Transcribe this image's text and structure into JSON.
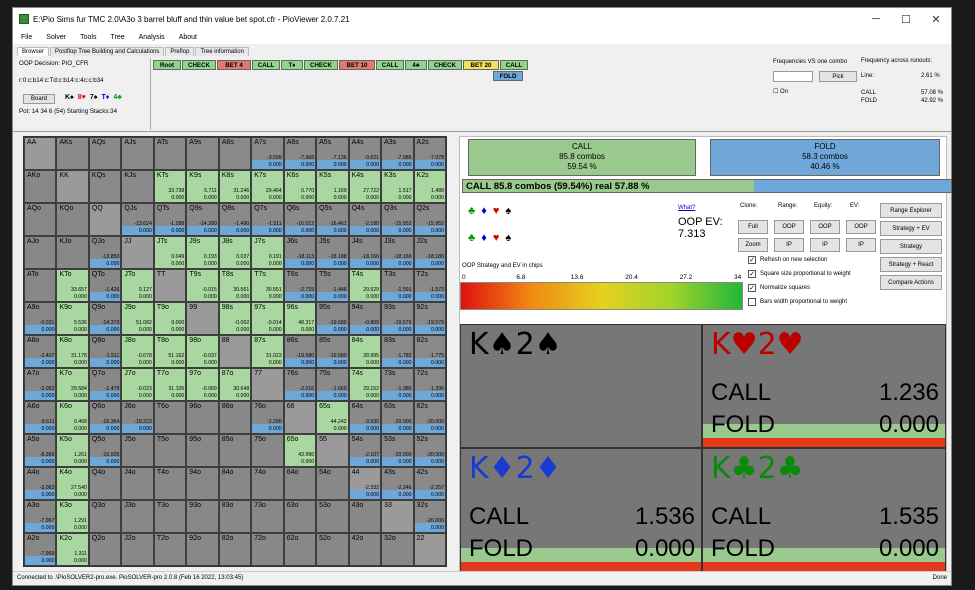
{
  "window": {
    "title": "E:\\Pio Sims fur TMC 2.0\\A3o 3 barrel bluff and thin value bet spot.cfr - PioViewer 2.0.7.21",
    "min": "─",
    "max": "☐",
    "close": "✕"
  },
  "menu": [
    "File",
    "Solver",
    "Tools",
    "Tree",
    "Analysis",
    "About"
  ],
  "tabs": [
    "Browser",
    "Postflop Tree Building and Calculations",
    "Preflop",
    "Tree information"
  ],
  "info": {
    "decision": "OOP Decision:  PIO_CFR",
    "line": "r:0:c:b14:c:Td:c:b14:c:4c:c:b34",
    "board_btn": "Board",
    "pot": "Pot: 14 34 6 (54) Starting Stacks:34"
  },
  "board_cards": [
    {
      "t": "K♠",
      "c": "#000"
    },
    {
      "t": "8♥",
      "c": "#d00"
    },
    {
      "t": "7♠",
      "c": "#000"
    },
    {
      "t": "T♦",
      "c": "#00c"
    },
    {
      "t": "4♣",
      "c": "#090"
    }
  ],
  "tree_nodes": [
    "Root",
    "CHECK",
    "BET 4",
    "CALL",
    "T♦",
    "CHECK",
    "BET 10",
    "CALL",
    "4♣",
    "CHECK",
    "BET 20",
    "CALL",
    "FOLD"
  ],
  "freq": {
    "title1": "Frequencies VS one combo",
    "title2": "Frequency across runouts:",
    "pick": "Pick",
    "on": "On",
    "line_label": "Line:",
    "line_val": "2.61 %",
    "call_label": "CALL",
    "call_val": "57.08 %",
    "fold_label": "FOLD",
    "fold_val": "42.92 %"
  },
  "grid": [
    [
      "AA",
      "AKs",
      "AQs",
      "AJs",
      "ATs",
      "A9s",
      "A8s",
      "A7s",
      "A6s",
      "A5s",
      "A4s",
      "A3s",
      "A2s"
    ],
    [
      "AKo",
      "KK",
      "KQs",
      "KJs",
      "KTs",
      "K9s",
      "K8s",
      "K7s",
      "K6s",
      "K5s",
      "K4s",
      "K3s",
      "K2s"
    ],
    [
      "AQo",
      "KQo",
      "QQ",
      "QJs",
      "QTs",
      "Q9s",
      "Q8s",
      "Q7s",
      "Q6s",
      "Q5s",
      "Q4s",
      "Q3s",
      "Q2s"
    ],
    [
      "AJo",
      "KJo",
      "QJo",
      "JJ",
      "JTs",
      "J9s",
      "J8s",
      "J7s",
      "J6s",
      "J5s",
      "J4s",
      "J3s",
      "J2s"
    ],
    [
      "ATo",
      "KTo",
      "QTo",
      "JTo",
      "TT",
      "T9s",
      "T8s",
      "T7s",
      "T6s",
      "T5s",
      "T4s",
      "T3s",
      "T2s"
    ],
    [
      "A9o",
      "K9o",
      "Q9o",
      "J9o",
      "T9o",
      "99",
      "98s",
      "97s",
      "96s",
      "95s",
      "94s",
      "93s",
      "92s"
    ],
    [
      "A8o",
      "K8o",
      "Q8o",
      "J8o",
      "T8o",
      "98o",
      "88",
      "87s",
      "86s",
      "85s",
      "84s",
      "83s",
      "82s"
    ],
    [
      "A7o",
      "K7o",
      "Q7o",
      "J7o",
      "T7o",
      "97o",
      "87o",
      "77",
      "76s",
      "75s",
      "74s",
      "73s",
      "72s"
    ],
    [
      "A6o",
      "K6o",
      "Q6o",
      "J6o",
      "T6o",
      "96o",
      "86o",
      "76o",
      "66",
      "65s",
      "64s",
      "63s",
      "62s"
    ],
    [
      "A5o",
      "K5o",
      "Q5o",
      "J5o",
      "T5o",
      "95o",
      "85o",
      "75o",
      "65o",
      "55",
      "54s",
      "53s",
      "52s"
    ],
    [
      "A4o",
      "K4o",
      "Q4o",
      "J4o",
      "T4o",
      "94o",
      "84o",
      "74o",
      "64o",
      "54o",
      "44",
      "43s",
      "42s"
    ],
    [
      "A3o",
      "K3o",
      "Q3o",
      "J3o",
      "T3o",
      "93o",
      "83o",
      "73o",
      "63o",
      "53o",
      "43o",
      "33",
      "32s"
    ],
    [
      "A2o",
      "K2o",
      "Q2o",
      "J2o",
      "T2o",
      "92o",
      "82o",
      "72o",
      "62o",
      "52o",
      "42o",
      "32o",
      "22"
    ]
  ],
  "grid_vals": {
    "0-7": [
      "-3.599",
      "0.000"
    ],
    "0-8": [
      "-7.968",
      "0.000"
    ],
    "0-9": [
      "-7.136",
      "0.000"
    ],
    "0-10": [
      "-0.621",
      "0.000"
    ],
    "0-11": [
      "-7.086",
      "0.000"
    ],
    "0-12": [
      "-7.078",
      "0.000"
    ],
    "1-4": [
      "33.738",
      "0.000"
    ],
    "1-5": [
      "5.711",
      "0.000"
    ],
    "1-6": [
      "31.246",
      "0.000"
    ],
    "1-7": [
      "29.464",
      "0.000"
    ],
    "1-8": [
      "0.770",
      "0.000"
    ],
    "1-9": [
      "1.169",
      "0.000"
    ],
    "1-10": [
      "27.722",
      "0.000"
    ],
    "1-11": [
      "1.517",
      "0.000"
    ],
    "1-12": [
      "1.488",
      "0.000"
    ],
    "2-3": [
      "-13.624",
      "0.000"
    ],
    "2-4": [
      "-1.288",
      "0.000"
    ],
    "2-5": [
      "-14.390",
      "0.000"
    ],
    "2-6": [
      "-1.490",
      "0.000"
    ],
    "2-7": [
      "-1.511",
      "0.000"
    ],
    "2-8": [
      "-16.012",
      "0.000"
    ],
    "2-9": [
      "-16.461",
      "0.000"
    ],
    "2-10": [
      "-2.190",
      "0.000"
    ],
    "2-11": [
      "-15.952",
      "0.000"
    ],
    "2-12": [
      "-15.952",
      "0.000"
    ],
    "3-2": [
      "-13.850",
      "0.000"
    ],
    "3-4": [
      "0.049",
      "0.000"
    ],
    "3-5": [
      "0.193",
      "0.000"
    ],
    "3-6": [
      "0.037",
      "0.000"
    ],
    "3-7": [
      "0.191",
      "0.000"
    ],
    "3-8": [
      "-18.113",
      "0.000"
    ],
    "3-9": [
      "-18.188",
      "0.000"
    ],
    "3-10": [
      "-18.166",
      "0.000"
    ],
    "3-11": [
      "-18.166",
      "0.000"
    ],
    "3-12": [
      "-18.180",
      "0.000"
    ],
    "4-1": [
      "33.657",
      "0.000"
    ],
    "4-2": [
      "-1.426",
      "0.000"
    ],
    "4-3": [
      "0.127",
      "0.000"
    ],
    "4-5": [
      "-0.015",
      "0.000"
    ],
    "4-6": [
      "30.561",
      "0.000"
    ],
    "4-7": [
      "30.551",
      "0.000"
    ],
    "4-8": [
      "-2.715",
      "0.000"
    ],
    "4-9": [
      "-1.446",
      "0.000"
    ],
    "4-10": [
      "29.529",
      "0.000"
    ],
    "4-11": [
      "-1.591",
      "0.000"
    ],
    "4-12": [
      "-1.573",
      "0.000"
    ],
    "5-0": [
      "-0.031",
      "0.000"
    ],
    "5-1": [
      "5.536",
      "0.000"
    ],
    "5-2": [
      "-14.373",
      "0.000"
    ],
    "5-3": [
      "51.082",
      "0.000"
    ],
    "5-4": [
      "0.000",
      "0.000"
    ],
    "5-6": [
      "-0.062",
      "0.000"
    ],
    "5-7": [
      "-0.014",
      "0.000"
    ],
    "5-8": [
      "48.317",
      "0.000"
    ],
    "5-9": [
      "-19.580",
      "0.000"
    ],
    "5-10": [
      "-0.809",
      "0.000"
    ],
    "5-11": [
      "-19.579",
      "0.000"
    ],
    "5-12": [
      "-19.579",
      "0.000"
    ],
    "6-0": [
      "-2.407",
      "0.000"
    ],
    "6-1": [
      "31.178",
      "0.000"
    ],
    "6-2": [
      "-1.511",
      "0.000"
    ],
    "6-3": [
      "-0.078",
      "0.000"
    ],
    "6-4": [
      "51.162",
      "0.000"
    ],
    "6-5": [
      "-0.037",
      "0.000"
    ],
    "6-7": [
      "31.023",
      "0.000"
    ],
    "6-8": [
      "-19.580",
      "0.000"
    ],
    "6-9": [
      "-19.580",
      "0.000"
    ],
    "6-10": [
      "28.995",
      "0.000"
    ],
    "6-11": [
      "-1.782",
      "0.000"
    ],
    "6-12": [
      "-1.775",
      "0.000"
    ],
    "7-0": [
      "-2.052",
      "0.000"
    ],
    "7-1": [
      "29.584",
      "0.000"
    ],
    "7-2": [
      "-1.478",
      "0.000"
    ],
    "7-3": [
      "-0.023",
      "0.000"
    ],
    "7-4": [
      "31.105",
      "0.000"
    ],
    "7-5": [
      "-0.069",
      "0.000"
    ],
    "7-6": [
      "30.648",
      "0.000"
    ],
    "7-8": [
      "-2.016",
      "0.000"
    ],
    "7-9": [
      "-1.669",
      "0.000"
    ],
    "7-10": [
      "29.152",
      "0.000"
    ],
    "7-11": [
      "-1.380",
      "0.000"
    ],
    "7-12": [
      "-1.396",
      "0.000"
    ],
    "8-0": [
      "-8.611",
      "0.000"
    ],
    "8-1": [
      "0.468",
      "0.000"
    ],
    "8-2": [
      "-16.364",
      "0.000"
    ],
    "8-3": [
      "-18.223",
      "0.000"
    ],
    "8-7": [
      "-2.290",
      "0.000"
    ],
    "8-9": [
      "44.242",
      "0.000"
    ],
    "8-10": [
      "-3.530",
      "0.000"
    ],
    "8-11": [
      "-20.000",
      "0.000"
    ],
    "8-12": [
      "-20.000",
      "0.000"
    ],
    "9-0": [
      "-8.366",
      "0.000"
    ],
    "9-1": [
      "1.261",
      "0.000"
    ],
    "9-2": [
      "-16.505",
      "0.000"
    ],
    "9-8": [
      "43.996",
      "0.000"
    ],
    "9-10": [
      "-2.107",
      "0.000"
    ],
    "9-11": [
      "-20.000",
      "0.000"
    ],
    "9-12": [
      "-20.000",
      "0.000"
    ],
    "10-0": [
      "-3.063",
      "0.000"
    ],
    "10-1": [
      "27.540",
      "0.000"
    ],
    "10-10": [
      "-2.332",
      "0.000"
    ],
    "10-11": [
      "-2.246",
      "0.000"
    ],
    "10-12": [
      "-2.257",
      "0.000"
    ],
    "11-0": [
      "-7.967",
      "0.000"
    ],
    "11-1": [
      "1.291",
      "0.000"
    ],
    "11-12": [
      "-20.000",
      "0.000"
    ],
    "12-0": [
      "-7.969",
      "0.000"
    ],
    "12-1": [
      "1.311",
      "0.000"
    ]
  },
  "summary": {
    "call_title": "CALL",
    "call_combos": "85.8 combos",
    "call_pct": "59.54 %",
    "fold_title": "FOLD",
    "fold_combos": "58.3 combos",
    "fold_pct": "40.46 %",
    "bar_text": "CALL  85.8 combos (59.54%) real  57.88 %"
  },
  "ev": {
    "what": "What?",
    "label": "OOP EV:",
    "value": "7.313",
    "clone": "Clone:",
    "range": "Range:",
    "equity": "Equity:",
    "evl": "EV:",
    "full": "Full",
    "zoom": "Zoom",
    "oop": "OOP",
    "ip": "IP"
  },
  "right_buttons": [
    "Range Explorer",
    "Strategy + EV",
    "Strategy",
    "Strategy + React",
    "Compare Actions"
  ],
  "checks": [
    {
      "t": "Refresh on new selection",
      "v": true
    },
    {
      "t": "Square size proportional to weight",
      "v": true
    },
    {
      "t": "Normalize squares",
      "v": true
    },
    {
      "t": "Bars width proportional to weight",
      "v": false
    }
  ],
  "scale": {
    "title": "OOP Strategy and EV in chips",
    "ticks": [
      "0",
      "6.8",
      "13.6",
      "20.4",
      "27.2",
      "34"
    ]
  },
  "combos": [
    {
      "name": "K♠2♠",
      "color": "#000",
      "call": "",
      "fold": ""
    },
    {
      "name": "K♥2♥",
      "color": "#b00",
      "call": "1.236",
      "fold": "0.000"
    },
    {
      "name": "K♦2♦",
      "color": "#1a3ad0",
      "call": "1.536",
      "fold": "0.000"
    },
    {
      "name": "K♣2♣",
      "color": "#0a8a0a",
      "call": "1.535",
      "fold": "0.000"
    }
  ],
  "combo_labels": {
    "call": "CALL",
    "fold": "FOLD"
  },
  "status": {
    "left": "Connected to .\\PioSOLVER2-pro.exe. PioSOLVER-pro 2.0.8 (Feb 16 2022, 13:03:45)",
    "right": "Done"
  }
}
